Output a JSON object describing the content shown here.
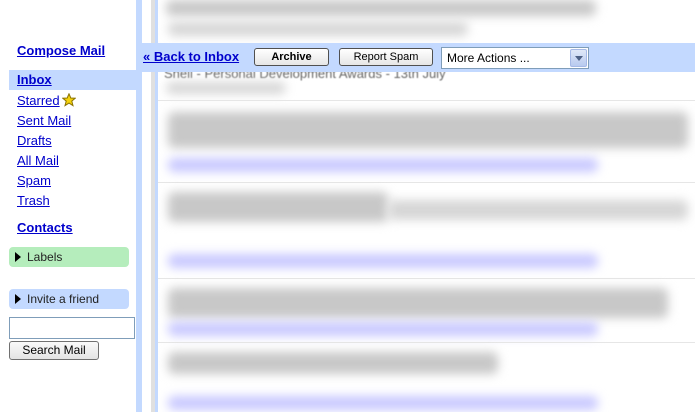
{
  "sidebar": {
    "compose": "Compose Mail",
    "items": [
      {
        "label": "Inbox"
      },
      {
        "label": "Starred"
      },
      {
        "label": "Sent Mail"
      },
      {
        "label": "Drafts"
      },
      {
        "label": "All Mail"
      },
      {
        "label": "Spam"
      },
      {
        "label": "Trash"
      }
    ],
    "contacts": "Contacts",
    "labels": "Labels",
    "invite": "Invite a friend",
    "search_button": "Search Mail",
    "search_value": ""
  },
  "toolbar": {
    "back": "« Back to Inbox",
    "archive": "Archive",
    "report_spam": "Report Spam",
    "more_actions": "More Actions ..."
  },
  "message": {
    "subject_fragment": "Shell - Personal Development Awards - 13th July"
  },
  "colors": {
    "link": "#0000cc",
    "selection": "#c3d9ff",
    "labels_bg": "#b5edbc"
  },
  "icons": [
    "star-icon",
    "triangle-right-icon",
    "dropdown-arrow-icon"
  ]
}
